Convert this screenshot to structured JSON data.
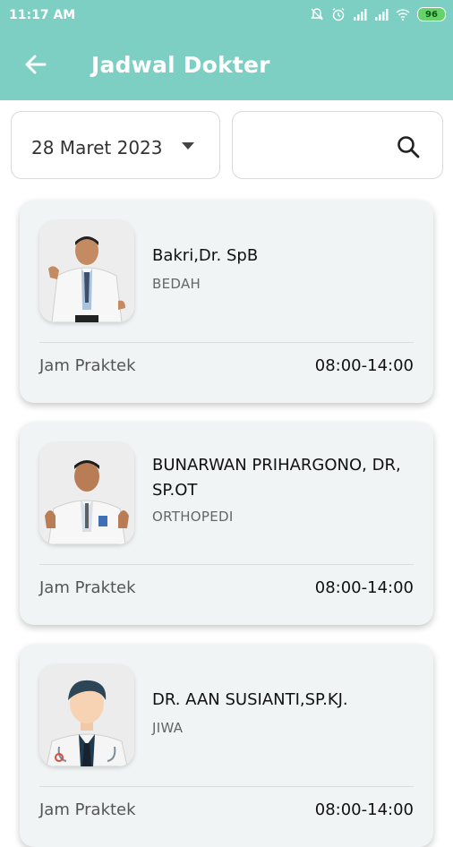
{
  "status_bar": {
    "time": "11:17 AM",
    "battery": "96",
    "icons": [
      "mute-bell-icon",
      "alarm-icon",
      "signal-icon",
      "signal-icon",
      "wifi-icon",
      "battery-icon"
    ]
  },
  "header": {
    "title": "Jadwal Dokter",
    "back_icon": "arrow-left-icon"
  },
  "filters": {
    "date_value": "28 Maret 2023",
    "search_value": "",
    "search_icon": "search-icon"
  },
  "colors": {
    "primary": "#7ccfc2",
    "card_bg": "#f0f4f4",
    "battery": "#66d36a"
  },
  "doctors": [
    {
      "name": "Bakri,Dr. SpB",
      "specialty": "BEDAH",
      "schedule_label": "Jam Praktek",
      "schedule_time": "08:00-14:00",
      "photo": "doctor-photo"
    },
    {
      "name": "BUNARWAN PRIHARGONO, DR, SP.OT",
      "specialty": "ORTHOPEDI",
      "schedule_label": "Jam Praktek",
      "schedule_time": "08:00-14:00",
      "photo": "doctor-photo"
    },
    {
      "name": "DR. AAN SUSIANTI,SP.KJ.",
      "specialty": "JIWA",
      "schedule_label": "Jam Praktek",
      "schedule_time": "08:00-14:00",
      "photo": "doctor-avatar-illustration"
    }
  ]
}
